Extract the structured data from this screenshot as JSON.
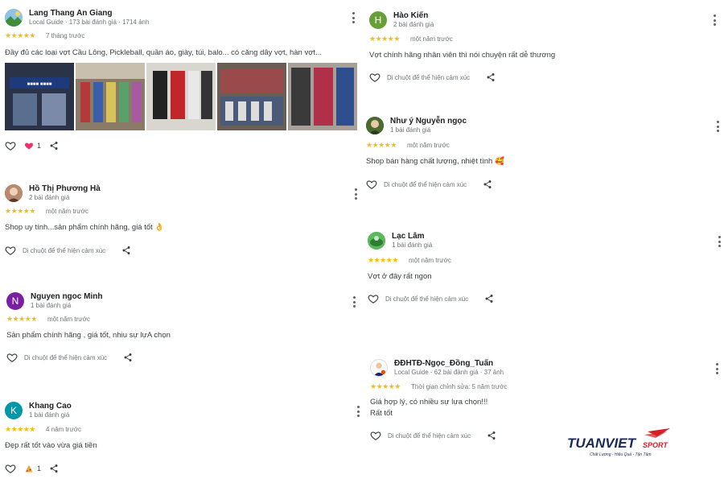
{
  "colors": {
    "star": "#fbbc04",
    "heart_filled": "#e8336b",
    "brand_red": "#d61f26",
    "brand_navy": "#1b2a5a"
  },
  "reviews": [
    {
      "name": "Lang Thang An Giang",
      "meta": "Local Guide · 173 bài đánh giá · 1714 ảnh",
      "stars": "★★★★★",
      "when": "7 tháng trước",
      "text": "Đầy đủ các loại vợt Cầu Lông, Pickleball, quần áo, giày, túi, balo... có căng dây vợt, hàn vợt...",
      "reaction_count": "1",
      "avatar_icon": "landscape-avatar"
    },
    {
      "name": "Hồ Thị Phương Hà",
      "meta": "2 bài đánh giá",
      "stars": "★★★★★",
      "when": "một năm trước",
      "text": "Shop uy tính...sản phẩm chính hãng, giá tốt 👌",
      "react_label": "Di chuột để thể hiện cảm xúc"
    },
    {
      "name": "Nguyen ngoc Minh",
      "meta": "1 bài đánh giá",
      "initial": "N",
      "stars": "★★★★★",
      "when": "một năm trước",
      "text": "Sản phẩm chính hãng , giá tốt, nhiu sự lựA chọn",
      "react_label": "Di chuột để thể hiện cảm xúc"
    },
    {
      "name": "Khang Cao",
      "meta": "1 bài đánh giá",
      "initial": "K",
      "stars": "★★★★★",
      "when": "4 năm trước",
      "text": "Đẹp rất tốt vào vừa giá tiền",
      "reaction_count": "1"
    },
    {
      "name": "Hào Kiến",
      "meta": "2 bài đánh giá",
      "initial": "H",
      "stars": "★★★★★",
      "when": "một năm trước",
      "text": "Vợt chính hãng nhân viên thì nói chuyện rất dễ thương",
      "react_label": "Di chuột để thể hiện cảm xúc"
    },
    {
      "name": "Như ý Nguyễn ngọc",
      "meta": "1 bài đánh giá",
      "stars": "★★★★★",
      "when": "một năm trước",
      "text": "Shop bán hàng chất lượng, nhiệt tình 🥰",
      "react_label": "Di chuột để thể hiện cảm xúc"
    },
    {
      "name": "Lạc Lâm",
      "meta": "1 bài đánh giá",
      "stars": "★★★★★",
      "when": "một năm trước",
      "text": "Vợt ở đây rất ngon",
      "react_label": "Di chuột để thể hiện cảm xúc"
    },
    {
      "name": "ĐĐHTĐ-Ngọc_Đồng_Tuấn",
      "meta": "Local Guide · 62 bài đánh giá · 37 ảnh",
      "stars": "★★★★★",
      "when": "Thời gian chỉnh sửa: 5 năm trước",
      "text": "Giá hợp lý, có nhiều sự lựa chọn!!!",
      "text2": "Rất tốt",
      "react_label": "Di chuột để thể hiện cảm xúc"
    }
  ],
  "brand": {
    "name": "TUANVIETSPORT",
    "tagline": "Chất Lượng - Hiệu Quả - Tận Tâm"
  }
}
